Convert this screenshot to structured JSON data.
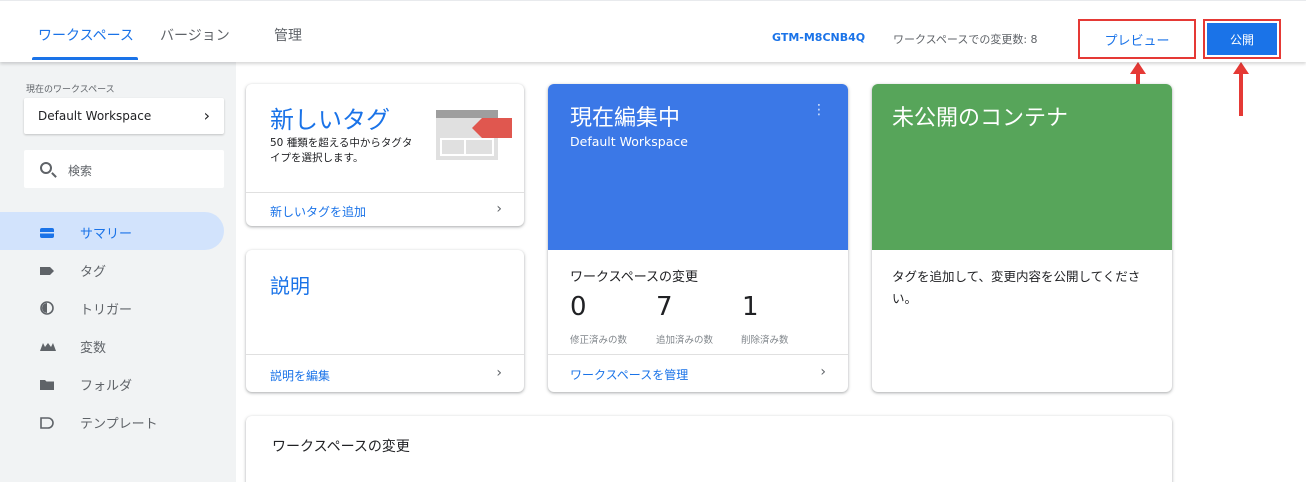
{
  "tabs": [
    {
      "label": "ワークスペース"
    },
    {
      "label": "バージョン"
    },
    {
      "label": "管理"
    }
  ],
  "header": {
    "container_id": "GTM-M8CNB4Q",
    "changes_count": "ワークスペースでの変更数: 8",
    "preview_label": "プレビュー",
    "publish_label": "公開"
  },
  "sidebar": {
    "workspace_label": "現在のワークスペース",
    "workspace_name": "Default Workspace",
    "search_placeholder": "検索",
    "items": [
      {
        "label": "サマリー",
        "icon": "summary-icon",
        "active": true
      },
      {
        "label": "タグ",
        "icon": "tag-icon",
        "active": false
      },
      {
        "label": "トリガー",
        "icon": "trigger-icon",
        "active": false
      },
      {
        "label": "変数",
        "icon": "variable-icon",
        "active": false
      },
      {
        "label": "フォルダ",
        "icon": "folder-icon",
        "active": false
      },
      {
        "label": "テンプレート",
        "icon": "template-icon",
        "active": false
      }
    ]
  },
  "cards": {
    "new_tag": {
      "title": "新しいタグ",
      "description": "50 種類を超える中からタグタイプを選択します。",
      "link": "新しいタグを追加"
    },
    "description": {
      "title": "説明",
      "link": "説明を編集"
    },
    "editing": {
      "title": "現在編集中",
      "subtitle": "Default Workspace",
      "menu": "⋮",
      "changes_title": "ワークスペースの変更",
      "stats": [
        {
          "value": "0",
          "label": "修正済みの数"
        },
        {
          "value": "7",
          "label": "追加済みの数"
        },
        {
          "value": "1",
          "label": "削除済み数"
        }
      ],
      "link": "ワークスペースを管理"
    },
    "unpublished": {
      "title": "未公開のコンテナ",
      "body": "タグを追加して、変更内容を公開してください。"
    },
    "workspace_changes": {
      "title": "ワークスペースの変更"
    }
  },
  "colors": {
    "accent": "#1a73e8",
    "editing_card": "#3b78e7",
    "unpublished_card": "#57a55a",
    "highlight": "#e53935"
  }
}
